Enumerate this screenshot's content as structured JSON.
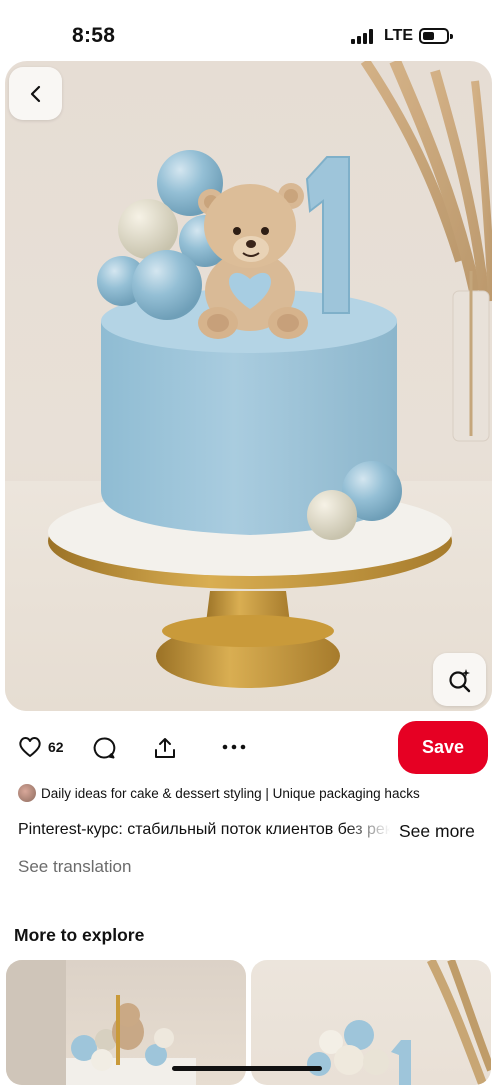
{
  "status_bar": {
    "time": "8:58",
    "network": "LTE"
  },
  "pin": {
    "likes_count": "62",
    "save_label": "Save",
    "creator_board": "Daily ideas for cake & dessert styling | Unique packaging hacks",
    "description": "Pinterest-курс: стабильный поток клиентов без рекламы",
    "see_more_label": "See more",
    "see_translation_label": "See translation"
  },
  "explore": {
    "heading": "More to explore"
  },
  "icons": {
    "back": "chevron-left-icon",
    "visual_search": "lens-search-icon",
    "like": "heart-icon",
    "comment": "comment-bubble-icon",
    "share": "share-upload-icon",
    "more": "ellipsis-icon"
  },
  "colors": {
    "save_button": "#e60023",
    "cake": "#a9ccdf",
    "stand_gold": "#c99a3a"
  }
}
